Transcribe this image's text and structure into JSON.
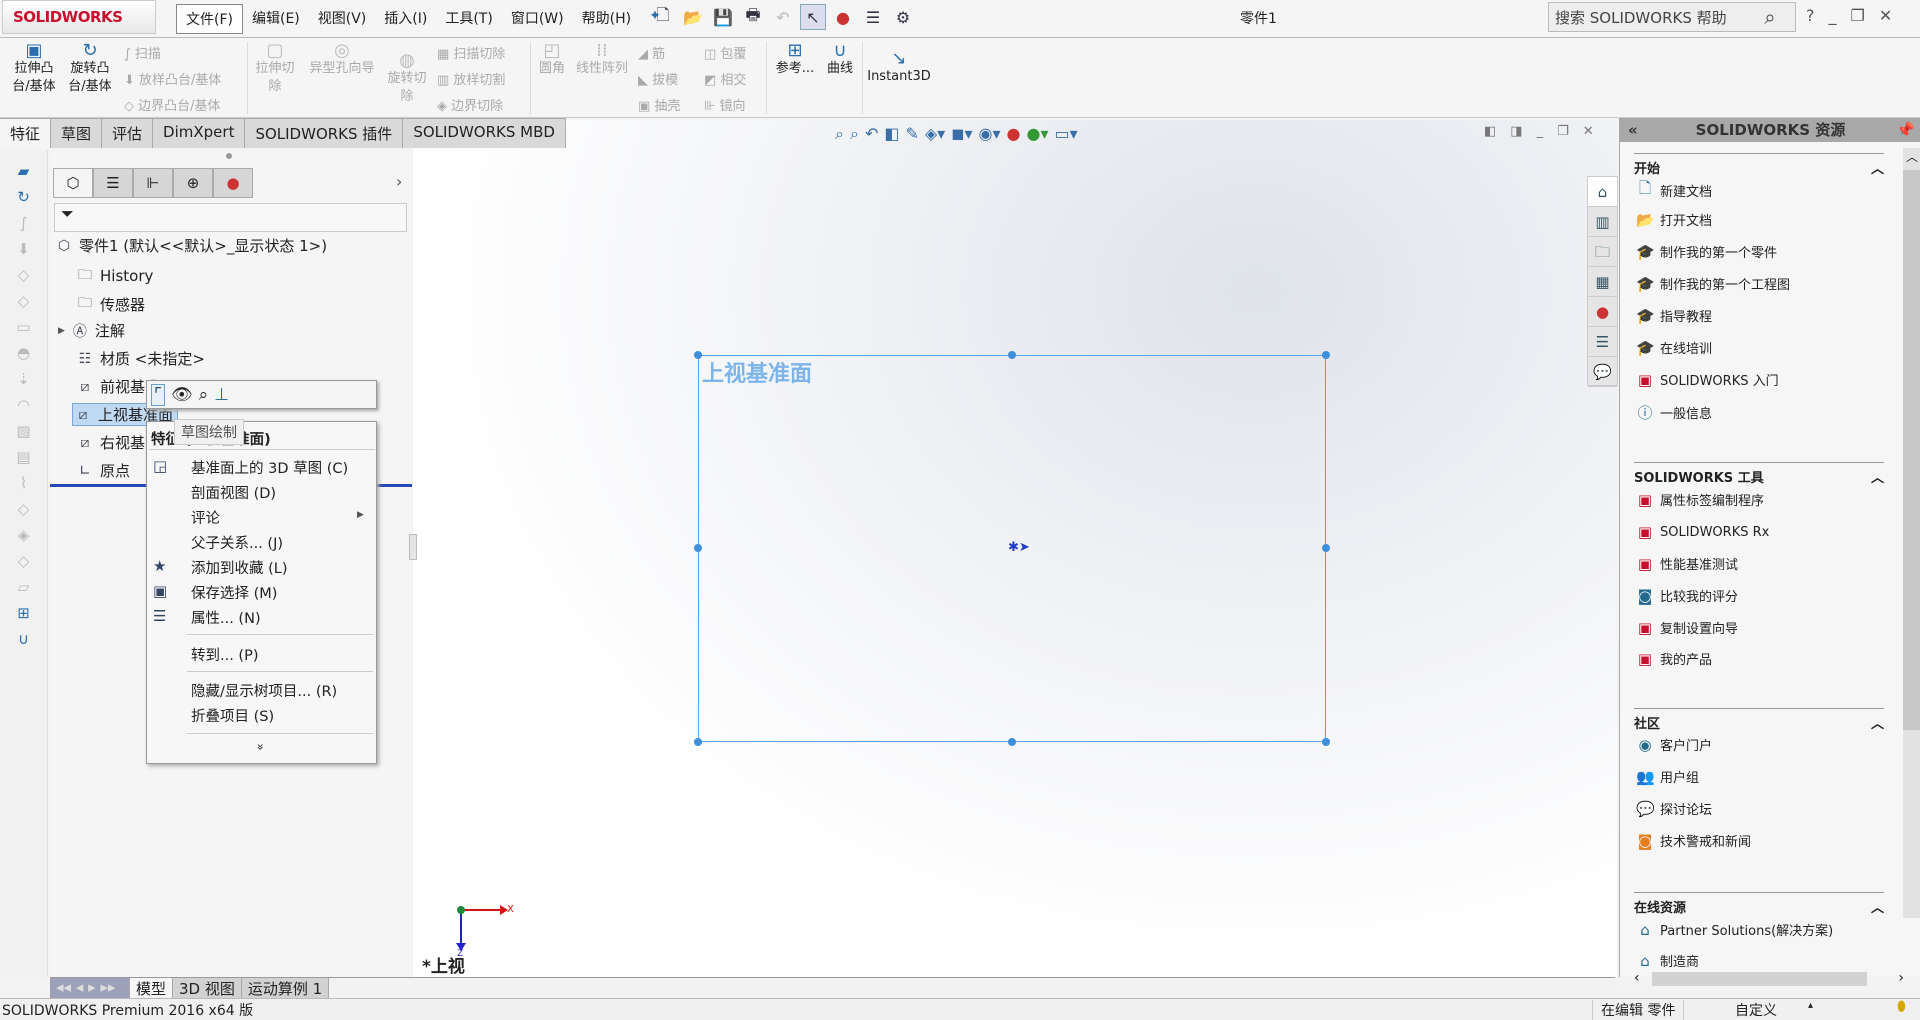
{
  "app": {
    "logo": "SOLIDWORKS",
    "doc_title": "零件1",
    "search_placeholder": "搜索 SOLIDWORKS 帮助"
  },
  "menu": [
    "文件(F)",
    "编辑(E)",
    "视图(V)",
    "插入(I)",
    "工具(T)",
    "窗口(W)",
    "帮助(H)"
  ],
  "ribbon": {
    "extrude_boss": "拉伸凸\n台/基体",
    "revolve_boss": "旋转凸\n台/基体",
    "sweep": "扫描",
    "loft": "放样凸台/基体",
    "boundary": "边界凸台/基体",
    "extrude_cut": "拉伸切\n除",
    "hole_wizard": "异型孔向导",
    "revolve_cut": "旋转切\n除",
    "swept_cut": "扫描切除",
    "lofted_cut": "放样切割",
    "boundary_cut": "边界切除",
    "fillet": "圆角",
    "linear_pattern": "线性阵列",
    "rib": "筋",
    "draft": "拔模",
    "shell": "抽壳",
    "wrap": "包覆",
    "intersect": "相交",
    "mirror": "镜向",
    "reference": "参考...",
    "curves": "曲线",
    "instant3d": "Instant3D"
  },
  "tabs": [
    "特征",
    "草图",
    "评估",
    "DimXpert",
    "SOLIDWORKS 插件",
    "SOLIDWORKS MBD"
  ],
  "tree": {
    "root": "零件1  (默认<<默认>_显示状态 1>)",
    "items": [
      "History",
      "传感器",
      "注解",
      "材质 <未指定>",
      "前视基准面",
      "上视基准面",
      "右视基准面",
      "原点"
    ]
  },
  "viewport": {
    "plane_label": "上视基准面",
    "view_name": "*上视",
    "triad_x": "X",
    "triad_z": "Z"
  },
  "tooltip": "草图绘制",
  "context_menu": {
    "title": "特征 (上视基准面)",
    "items": [
      "基准面上的 3D 草图 (C)",
      "剖面视图 (D)",
      "评论",
      "父子关系... (J)",
      "添加到收藏 (L)",
      "保存选择 (M)",
      "属性... (N)",
      "转到... (P)",
      "隐藏/显示树项目... (R)",
      "折叠项目 (S)"
    ],
    "more": "»"
  },
  "resources": {
    "title": "SOLIDWORKS 资源",
    "sections": [
      {
        "title": "开始",
        "items": [
          "新建文档",
          "打开文档",
          "制作我的第一个零件",
          "制作我的第一个工程图",
          "指导教程",
          "在线培训",
          "SOLIDWORKS 入门",
          "一般信息"
        ]
      },
      {
        "title": "SOLIDWORKS 工具",
        "items": [
          "属性标签编制程序",
          "SOLIDWORKS Rx",
          "性能基准测试",
          "比较我的评分",
          "复制设置向导",
          "我的产品"
        ]
      },
      {
        "title": "社区",
        "items": [
          "客户门户",
          "用户组",
          "探讨论坛",
          "技术警戒和新闻"
        ]
      },
      {
        "title": "在线资源",
        "items": [
          "Partner Solutions(解决方案)",
          "制造商"
        ]
      }
    ]
  },
  "bottom_tabs": [
    "模型",
    "3D 视图",
    "运动算例 1"
  ],
  "status": {
    "product": "SOLIDWORKS Premium 2016 x64 版",
    "mode": "在编辑 零件",
    "units": "自定义"
  },
  "colors": {
    "accent": "#2747b8",
    "plane": "#5aa3e6",
    "brand": "#c8102e"
  }
}
